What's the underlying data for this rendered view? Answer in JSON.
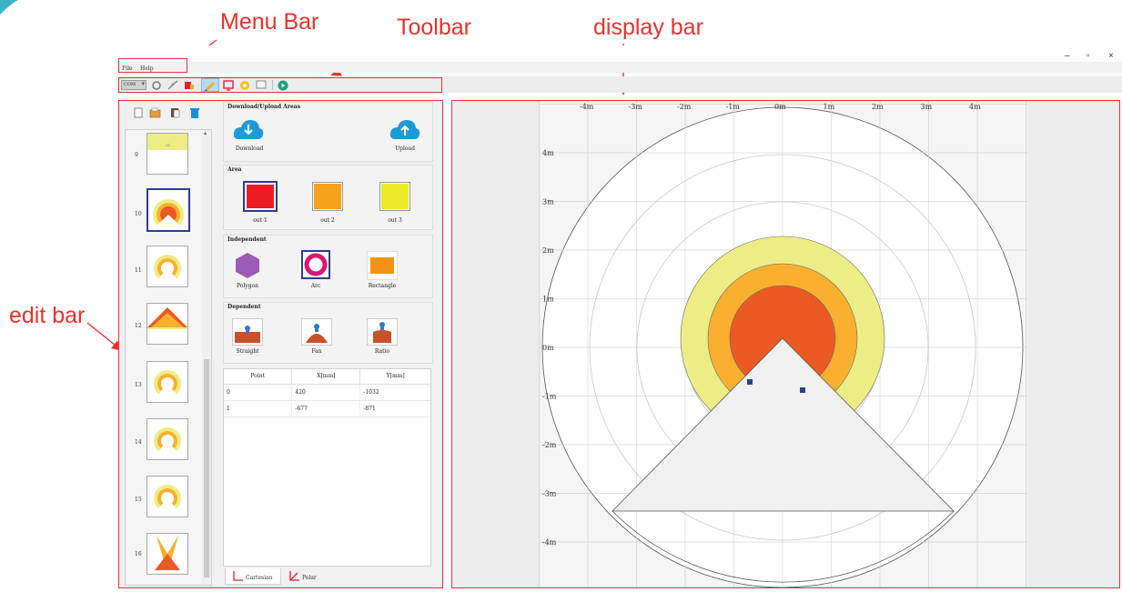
{
  "annotations": {
    "menu_bar": "Menu Bar",
    "toolbar": "Toolbar",
    "display_bar": "display bar",
    "edit_bar": "edit bar"
  },
  "window_controls": {
    "minimize": "–",
    "maximize": "▫",
    "close": "×"
  },
  "menu": {
    "file": "File",
    "help": "Help"
  },
  "toolbar": {
    "combo_value": "COM"
  },
  "download_upload": {
    "title": "Download/Upload Areas",
    "download_label": "Download",
    "upload_label": "Upload"
  },
  "area": {
    "title": "Area",
    "items": [
      {
        "label": "out 1",
        "color": "#ee1c24"
      },
      {
        "label": "out 2",
        "color": "#f7a21b"
      },
      {
        "label": "out 3",
        "color": "#eaea2a"
      }
    ]
  },
  "independent": {
    "title": "Independent",
    "items": [
      {
        "label": "Polygon"
      },
      {
        "label": "Arc"
      },
      {
        "label": "Rectangle"
      }
    ]
  },
  "dependent": {
    "title": "Dependent",
    "items": [
      {
        "label": "Straight"
      },
      {
        "label": "Fan"
      },
      {
        "label": "Ratio"
      }
    ]
  },
  "point_table": {
    "headers": [
      "Point",
      "X[mm]",
      "Y[mm]"
    ],
    "rows": [
      [
        "0",
        "420",
        "-1032"
      ],
      [
        "1",
        "-677",
        "-871"
      ]
    ]
  },
  "coord_tabs": {
    "cartesian": "Cartesian",
    "polar": "Polar"
  },
  "field_list": {
    "items": [
      {
        "num": "9"
      },
      {
        "num": "10"
      },
      {
        "num": "11"
      },
      {
        "num": "12"
      },
      {
        "num": "13"
      },
      {
        "num": "14"
      },
      {
        "num": "15"
      },
      {
        "num": "16"
      }
    ]
  },
  "display": {
    "x_ticks": [
      "-4m",
      "-3m",
      "-2m",
      "-1m",
      "0m",
      "1m",
      "2m",
      "3m",
      "4m"
    ],
    "y_ticks": [
      "4m",
      "3m",
      "2m",
      "1m",
      "0m",
      "-1m",
      "-2m",
      "-3m",
      "-4m"
    ],
    "field_colors": {
      "outer": "#eded86",
      "middle": "#f9b02e",
      "inner": "#ec5a24"
    }
  }
}
